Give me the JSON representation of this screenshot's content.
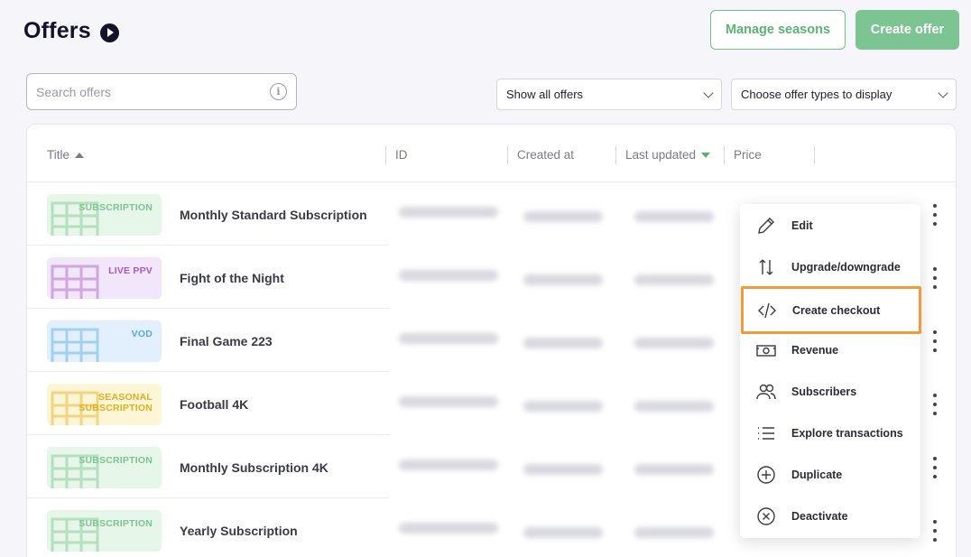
{
  "header": {
    "title": "Offers",
    "manage_seasons_label": "Manage seasons",
    "create_offer_label": "Create offer"
  },
  "search": {
    "placeholder": "Search offers",
    "value": ""
  },
  "filters": {
    "show_offers": "Show all offers",
    "offer_types": "Choose offer types to display"
  },
  "table": {
    "columns": [
      "Title",
      "ID",
      "Created at",
      "Last updated",
      "Price"
    ],
    "rows": [
      {
        "type_label": "SUBSCRIPTION",
        "title": "Monthly Standard Subscription",
        "theme": "green"
      },
      {
        "type_label": "LIVE PPV",
        "title": "Fight of the Night",
        "theme": "purple"
      },
      {
        "type_label": "VOD",
        "title": "Final Game 223",
        "theme": "blue"
      },
      {
        "type_label": "SEASONAL SUBSCRIPTION",
        "title": "Football 4K",
        "theme": "yellow"
      },
      {
        "type_label": "SUBSCRIPTION",
        "title": "Monthly Subscription 4K",
        "theme": "green"
      },
      {
        "type_label": "SUBSCRIPTION",
        "title": "Yearly Subscription",
        "theme": "green"
      }
    ]
  },
  "menu": {
    "items": [
      {
        "label": "Edit",
        "icon": "pencil-icon"
      },
      {
        "label": "Upgrade/downgrade",
        "icon": "up-down-arrows-icon"
      },
      {
        "label": "Create checkout",
        "icon": "code-icon"
      },
      {
        "label": "Revenue",
        "icon": "banknote-icon"
      },
      {
        "label": "Subscribers",
        "icon": "users-icon"
      },
      {
        "label": "Explore transactions",
        "icon": "list-icon"
      },
      {
        "label": "Duplicate",
        "icon": "plus-circle-icon"
      },
      {
        "label": "Deactivate",
        "icon": "x-circle-icon"
      }
    ]
  },
  "colors": {
    "accent_green": "#5db374",
    "highlight_orange": "#f29a3a",
    "subscription_bg": "#e6f6e8",
    "subscription_fg": "#7cc491",
    "liveppv_bg": "#f2e6fa",
    "liveppv_fg": "#a45cc4",
    "vod_bg": "#e1f0fc",
    "vod_fg": "#5aa8e0",
    "seasonal_bg": "#fcf5d6",
    "seasonal_fg": "#e0b020"
  }
}
